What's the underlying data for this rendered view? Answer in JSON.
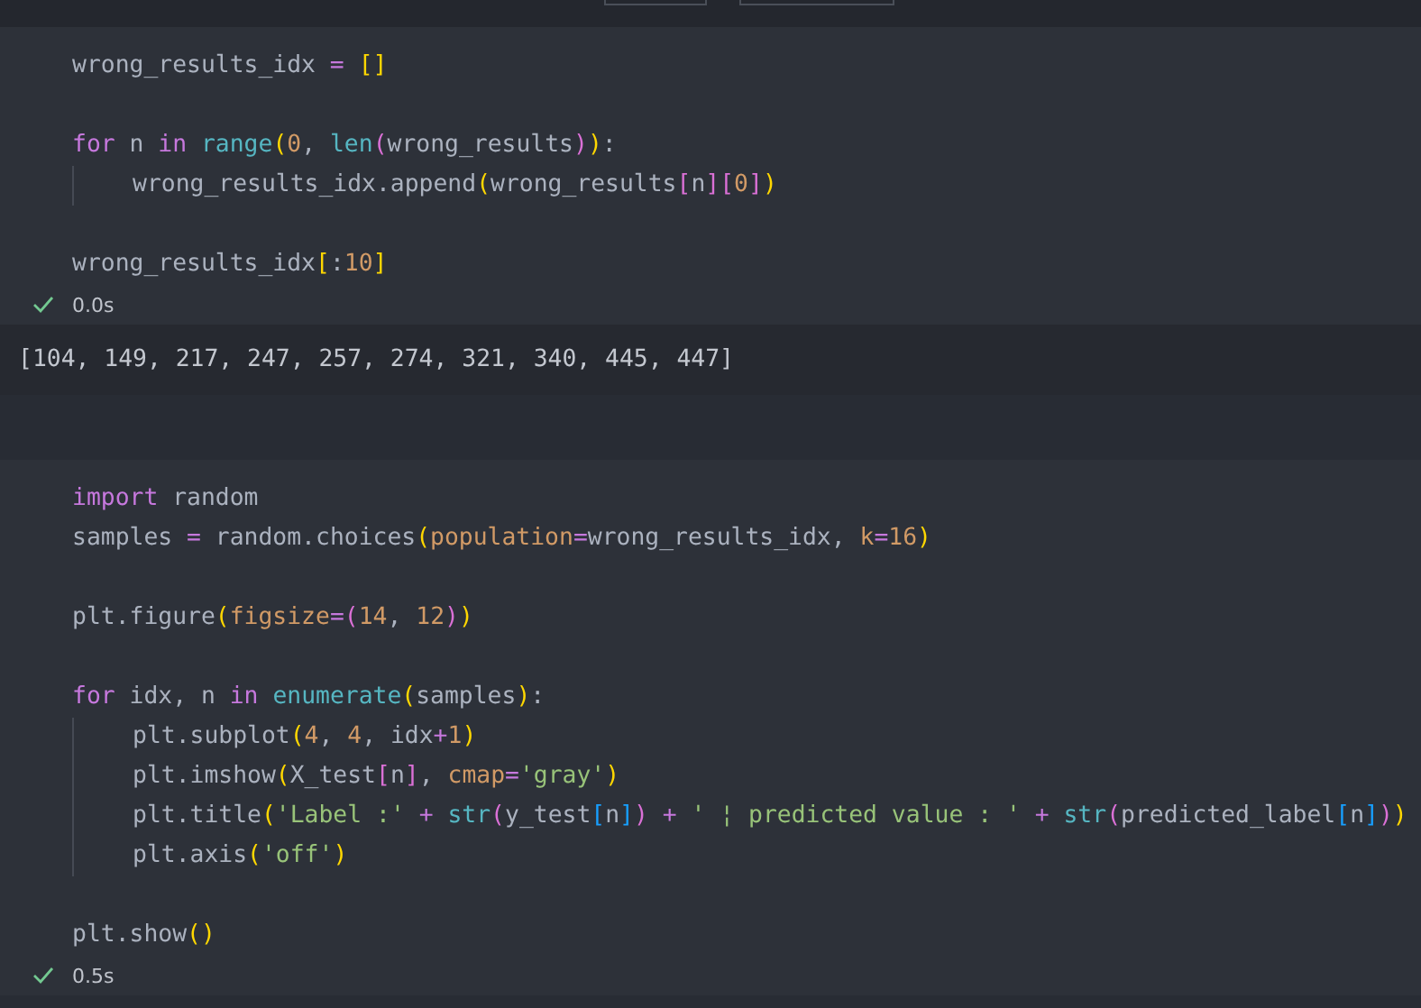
{
  "cells": [
    {
      "code": [
        [
          {
            "tokens": [
              {
                "kind": "plain",
                "text": "wrong_results_idx "
              },
              {
                "kind": "op",
                "text": "= "
              },
              {
                "kind": "b1",
                "text": "[]"
              }
            ]
          }
        ],
        [
          {
            "tokens": [
              {
                "kind": "kw",
                "text": "for"
              },
              {
                "kind": "plain",
                "text": " n "
              },
              {
                "kind": "kw",
                "text": "in "
              },
              {
                "kind": "fn",
                "text": "range"
              },
              {
                "kind": "b1",
                "text": "("
              },
              {
                "kind": "num",
                "text": "0"
              },
              {
                "kind": "plain",
                "text": ", "
              },
              {
                "kind": "fn",
                "text": "len"
              },
              {
                "kind": "b2",
                "text": "("
              },
              {
                "kind": "plain",
                "text": "wrong_results"
              },
              {
                "kind": "b2",
                "text": ")"
              },
              {
                "kind": "b1",
                "text": ")"
              },
              {
                "kind": "plain",
                "text": ":"
              }
            ],
            "children": [
              {
                "tokens": [
                  {
                    "kind": "plain",
                    "text": "wrong_results_idx.append"
                  },
                  {
                    "kind": "b1",
                    "text": "("
                  },
                  {
                    "kind": "plain",
                    "text": "wrong_results"
                  },
                  {
                    "kind": "b2",
                    "text": "["
                  },
                  {
                    "kind": "plain",
                    "text": "n"
                  },
                  {
                    "kind": "b2",
                    "text": "]"
                  },
                  {
                    "kind": "b2",
                    "text": "["
                  },
                  {
                    "kind": "num",
                    "text": "0"
                  },
                  {
                    "kind": "b2",
                    "text": "]"
                  },
                  {
                    "kind": "b1",
                    "text": ")"
                  }
                ]
              }
            ]
          }
        ],
        [
          {
            "tokens": [
              {
                "kind": "plain",
                "text": "wrong_results_idx"
              },
              {
                "kind": "b1",
                "text": "["
              },
              {
                "kind": "plain",
                "text": ":"
              },
              {
                "kind": "num",
                "text": "10"
              },
              {
                "kind": "b1",
                "text": "]"
              }
            ]
          }
        ]
      ],
      "status": {
        "succeeded": true,
        "time": "0.0s"
      },
      "output": "[104, 149, 217, 247, 257, 274, 321, 340, 445, 447]"
    },
    {
      "code": [
        [
          {
            "tokens": [
              {
                "kind": "kw",
                "text": "import"
              },
              {
                "kind": "plain",
                "text": " random"
              }
            ]
          },
          {
            "tokens": [
              {
                "kind": "plain",
                "text": "samples "
              },
              {
                "kind": "op",
                "text": "="
              },
              {
                "kind": "plain",
                "text": " random.choices"
              },
              {
                "kind": "b1",
                "text": "("
              },
              {
                "kind": "param",
                "text": "population"
              },
              {
                "kind": "op",
                "text": "="
              },
              {
                "kind": "plain",
                "text": "wrong_results_idx, "
              },
              {
                "kind": "param",
                "text": "k"
              },
              {
                "kind": "op",
                "text": "="
              },
              {
                "kind": "num",
                "text": "16"
              },
              {
                "kind": "b1",
                "text": ")"
              }
            ]
          }
        ],
        [
          {
            "tokens": [
              {
                "kind": "plain",
                "text": "plt.figure"
              },
              {
                "kind": "b1",
                "text": "("
              },
              {
                "kind": "param",
                "text": "figsize"
              },
              {
                "kind": "op",
                "text": "="
              },
              {
                "kind": "b2",
                "text": "("
              },
              {
                "kind": "num",
                "text": "14"
              },
              {
                "kind": "plain",
                "text": ", "
              },
              {
                "kind": "num",
                "text": "12"
              },
              {
                "kind": "b2",
                "text": ")"
              },
              {
                "kind": "b1",
                "text": ")"
              }
            ]
          }
        ],
        [
          {
            "tokens": [
              {
                "kind": "kw",
                "text": "for"
              },
              {
                "kind": "plain",
                "text": " idx, n "
              },
              {
                "kind": "kw",
                "text": "in "
              },
              {
                "kind": "fn",
                "text": "enumerate"
              },
              {
                "kind": "b1",
                "text": "("
              },
              {
                "kind": "plain",
                "text": "samples"
              },
              {
                "kind": "b1",
                "text": ")"
              },
              {
                "kind": "plain",
                "text": ":"
              }
            ],
            "children": [
              {
                "tokens": [
                  {
                    "kind": "plain",
                    "text": "plt.subplot"
                  },
                  {
                    "kind": "b1",
                    "text": "("
                  },
                  {
                    "kind": "num",
                    "text": "4"
                  },
                  {
                    "kind": "plain",
                    "text": ", "
                  },
                  {
                    "kind": "num",
                    "text": "4"
                  },
                  {
                    "kind": "plain",
                    "text": ", idx"
                  },
                  {
                    "kind": "op",
                    "text": "+"
                  },
                  {
                    "kind": "num",
                    "text": "1"
                  },
                  {
                    "kind": "b1",
                    "text": ")"
                  }
                ]
              },
              {
                "tokens": [
                  {
                    "kind": "plain",
                    "text": "plt.imshow"
                  },
                  {
                    "kind": "b1",
                    "text": "("
                  },
                  {
                    "kind": "plain",
                    "text": "X_test"
                  },
                  {
                    "kind": "b2",
                    "text": "["
                  },
                  {
                    "kind": "plain",
                    "text": "n"
                  },
                  {
                    "kind": "b2",
                    "text": "]"
                  },
                  {
                    "kind": "plain",
                    "text": ", "
                  },
                  {
                    "kind": "param",
                    "text": "cmap"
                  },
                  {
                    "kind": "op",
                    "text": "="
                  },
                  {
                    "kind": "str",
                    "text": "'gray'"
                  },
                  {
                    "kind": "b1",
                    "text": ")"
                  }
                ]
              },
              {
                "tokens": [
                  {
                    "kind": "plain",
                    "text": "plt.title"
                  },
                  {
                    "kind": "b1",
                    "text": "("
                  },
                  {
                    "kind": "str",
                    "text": "'Label :'"
                  },
                  {
                    "kind": "op",
                    "text": " + "
                  },
                  {
                    "kind": "fn",
                    "text": "str"
                  },
                  {
                    "kind": "b2",
                    "text": "("
                  },
                  {
                    "kind": "plain",
                    "text": "y_test"
                  },
                  {
                    "kind": "b3",
                    "text": "["
                  },
                  {
                    "kind": "plain",
                    "text": "n"
                  },
                  {
                    "kind": "b3",
                    "text": "]"
                  },
                  {
                    "kind": "b2",
                    "text": ")"
                  },
                  {
                    "kind": "op",
                    "text": " + "
                  },
                  {
                    "kind": "str",
                    "text": "' ¦ predicted value : '"
                  },
                  {
                    "kind": "op",
                    "text": " + "
                  },
                  {
                    "kind": "fn",
                    "text": "str"
                  },
                  {
                    "kind": "b2",
                    "text": "("
                  },
                  {
                    "kind": "plain",
                    "text": "predicted_label"
                  },
                  {
                    "kind": "b3",
                    "text": "["
                  },
                  {
                    "kind": "plain",
                    "text": "n"
                  },
                  {
                    "kind": "b3",
                    "text": "]"
                  },
                  {
                    "kind": "b2",
                    "text": ")"
                  },
                  {
                    "kind": "b1",
                    "text": ")"
                  }
                ]
              },
              {
                "tokens": [
                  {
                    "kind": "plain",
                    "text": "plt.axis"
                  },
                  {
                    "kind": "b1",
                    "text": "("
                  },
                  {
                    "kind": "str",
                    "text": "'off'"
                  },
                  {
                    "kind": "b1",
                    "text": ")"
                  }
                ]
              }
            ]
          }
        ],
        [
          {
            "tokens": [
              {
                "kind": "plain",
                "text": "plt.show"
              },
              {
                "kind": "b1",
                "text": "()"
              }
            ]
          }
        ]
      ],
      "status": {
        "succeeded": true,
        "time": "0.5s"
      }
    }
  ]
}
